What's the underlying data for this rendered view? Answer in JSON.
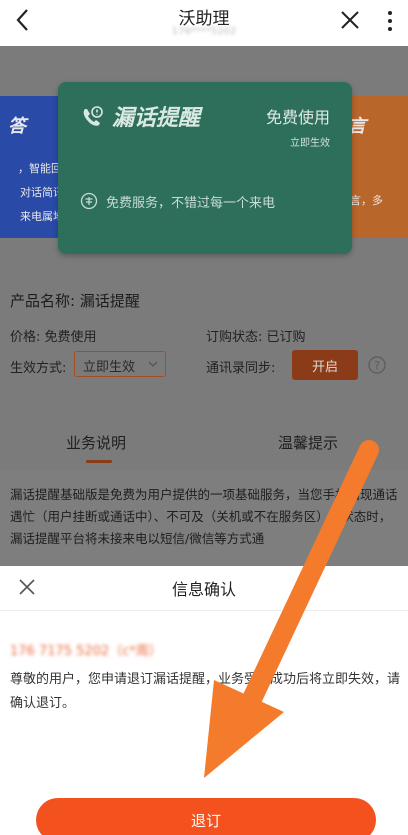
{
  "header": {
    "title": "沃助理",
    "subtitle": "176****5202"
  },
  "cards": {
    "left_big": "答",
    "left_line1": "，智能回",
    "left_line2": "对话简讯",
    "left_line3": "来电属地",
    "main_name": "漏话提醒",
    "main_free": "免费使用",
    "main_effect": "立即生效",
    "main_service": "免费服务，不错过每一个来电",
    "right_big": "言",
    "right_line1": "言，多"
  },
  "product": {
    "name_line": "产品名称: 漏话提醒",
    "price": "价格: 免费使用",
    "order_status": "订购状态: 已订购",
    "mode_label": "生效方式:",
    "mode_value": "立即生效",
    "sync_label": "通讯录同步:",
    "sync_button": "开启"
  },
  "tabs": [
    "业务说明",
    "温馨提示"
  ],
  "description": "漏话提醒基础版是免费为用户提供的一项基础服务，当您手机出现通话遇忙（用户挂断或通话中）、不可及（关机或不在服务区）等状态时，漏话提醒平台将未接来电以短信/微信等方式通",
  "sheet": {
    "title": "信息确认",
    "phone": "176 7175 5202（c*周）",
    "message": "尊敬的用户，您申请退订漏话提醒，业务受理成功后将立即失效，请确认退订。",
    "confirm": "退订"
  },
  "colors": {
    "accent": "#f3521e",
    "card_green": "#2e6f5c",
    "arrow": "#f47a2c"
  }
}
